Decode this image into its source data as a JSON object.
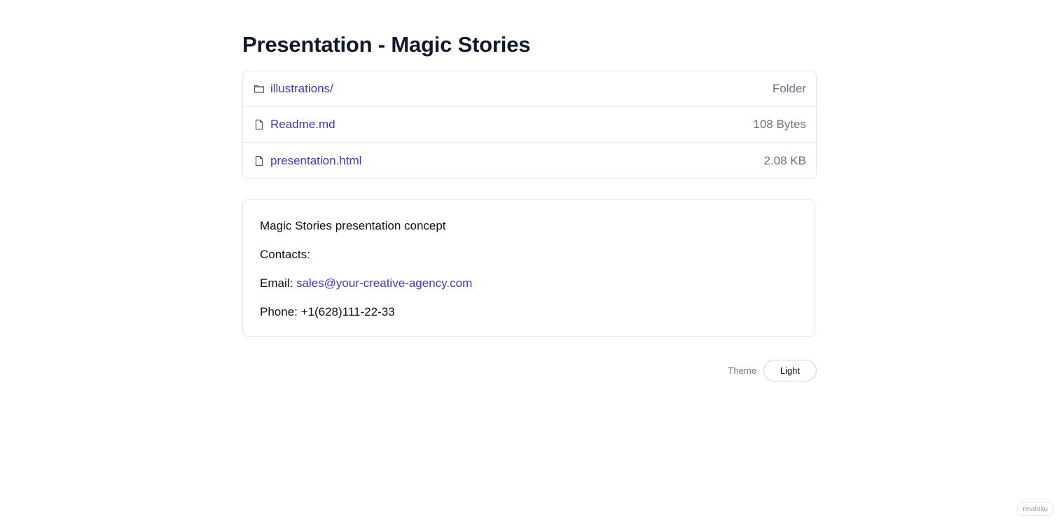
{
  "page": {
    "title": "Presentation - Magic Stories"
  },
  "files": [
    {
      "icon": "folder-icon",
      "name": "illustrations/",
      "meta": "Folder"
    },
    {
      "icon": "file-icon",
      "name": "Readme.md",
      "meta": "108 Bytes"
    },
    {
      "icon": "file-icon",
      "name": "presentation.html",
      "meta": "2.08 KB"
    }
  ],
  "readme": {
    "intro": "Magic Stories presentation concept",
    "contacts_label": "Contacts:",
    "email_label": "Email:",
    "email_value": "sales@your-creative-agency.com",
    "phone_text": "Phone: +1(628)111-22-33"
  },
  "footer": {
    "theme_label": "Theme",
    "theme_button": "Light"
  },
  "badge": {
    "text": "revdoku"
  },
  "colors": {
    "link": "#4338ca",
    "title": "#111827",
    "muted": "#6b7280",
    "border": "#e5e7eb"
  }
}
